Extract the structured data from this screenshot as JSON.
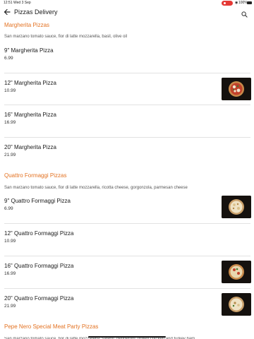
{
  "status_bar": {
    "time": "12:51",
    "date": "Wed 3 Sep",
    "battery": "100%"
  },
  "header": {
    "title": "Pizzas Delivery"
  },
  "sections": [
    {
      "title": "Margherita Pizzas",
      "description": "San marzano tomato sauce, fior di latte mozzarella, basil, olive oil",
      "items": [
        {
          "name": "9\" Margherita Pizza",
          "price": "6.99"
        },
        {
          "name": "12\" Margherita Pizza",
          "price": "10.99"
        },
        {
          "name": "16\" Margherita Pizza",
          "price": "16.99"
        },
        {
          "name": "20\" Margherita Pizza",
          "price": "21.99"
        }
      ]
    },
    {
      "title": "Quattro Formaggi Pizzas",
      "description": "San marzano tomato sauce, fior di latte mozzarella, ricotta cheese, gorgonzola, parmesan cheese",
      "items": [
        {
          "name": "9\" Quattro Formaggi Pizza",
          "price": "6.99"
        },
        {
          "name": "12\" Quattro Formaggi Pizza",
          "price": "10.99"
        },
        {
          "name": "16\" Quattro Formaggi Pizza",
          "price": "16.99"
        },
        {
          "name": "20\" Quattro Formaggi Pizza",
          "price": "21.99"
        }
      ]
    },
    {
      "title": "Pepe Nero Special Meat Party Pizzas",
      "description": "San marzano tomato sauce, fior di latte mozzarella, salami, pepperoni, grilled chicken and turkey ham"
    }
  ],
  "colors": {
    "accent": "#e37222",
    "text": "#1a1a1a",
    "divider": "#e2e2e2"
  }
}
